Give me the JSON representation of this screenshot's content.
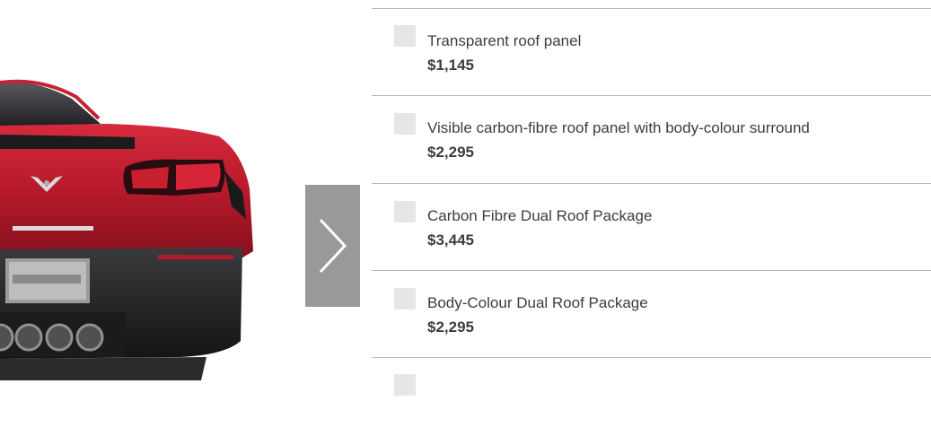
{
  "carousel": {
    "vehicle_image": "red-corvette-rear-view",
    "next_icon": "chevron-right-icon"
  },
  "options": [
    {
      "label": "Transparent roof panel",
      "price": "$1,145"
    },
    {
      "label": "Visible carbon-fibre roof panel with body-colour surround",
      "price": "$2,295"
    },
    {
      "label": "Carbon Fibre Dual Roof Package",
      "price": "$3,445"
    },
    {
      "label": "Body-Colour Dual Roof Package",
      "price": "$2,295"
    }
  ]
}
